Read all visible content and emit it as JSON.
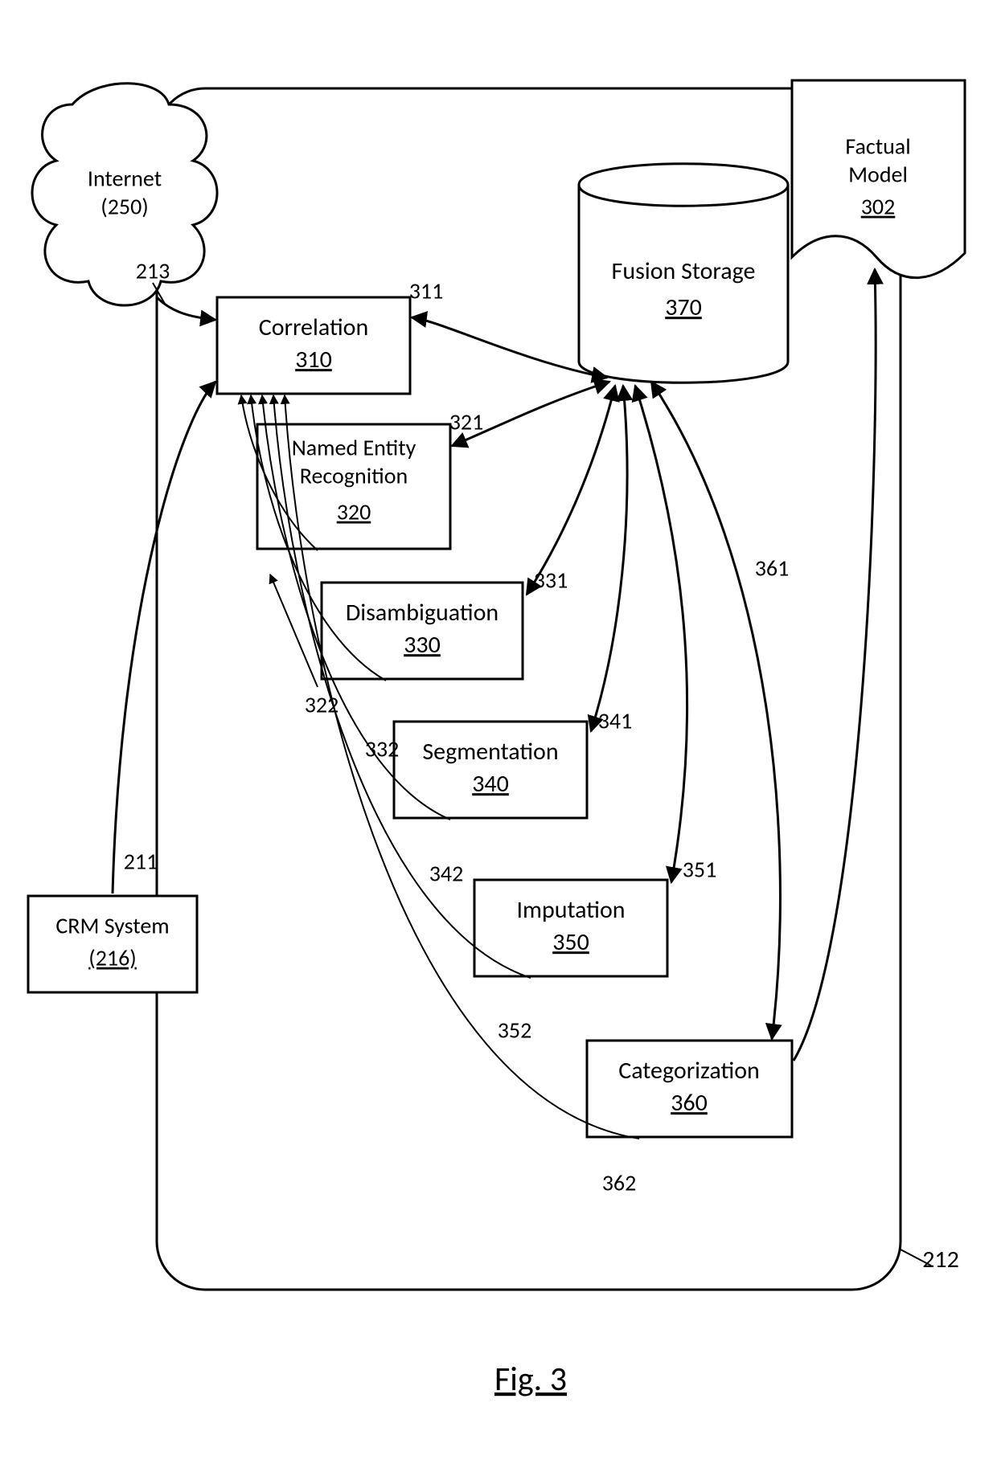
{
  "figure_label": "Fig. 3",
  "container_ref": "212",
  "external": {
    "internet": {
      "label": "Internet",
      "ref": "(250)"
    },
    "crm": {
      "label": "CRM System",
      "ref": "(216)"
    },
    "factual": {
      "label": "Factual Model",
      "ref": "302"
    }
  },
  "edges_in": {
    "internet_to_correlation": "213",
    "crm_to_correlation": "211"
  },
  "storage": {
    "label": "Fusion Storage",
    "ref": "370"
  },
  "stages": {
    "correlation": {
      "label": "Correlation",
      "ref": "310"
    },
    "ner": {
      "label": "Named Entity Recognition",
      "ref": "320"
    },
    "disambiguation": {
      "label": "Disambiguation",
      "ref": "330"
    },
    "segmentation": {
      "label": "Segmentation",
      "ref": "340"
    },
    "imputation": {
      "label": "Imputation",
      "ref": "350"
    },
    "categorization": {
      "label": "Categorization",
      "ref": "360"
    }
  },
  "storage_links": {
    "correlation": "311",
    "ner": "321",
    "disambiguation": "331",
    "segmentation": "341",
    "imputation": "351",
    "categorization": "361"
  },
  "feedback_to_correlation": {
    "ner": "322",
    "disambiguation": "332",
    "segmentation": "342",
    "imputation": "352",
    "categorization": "362"
  }
}
